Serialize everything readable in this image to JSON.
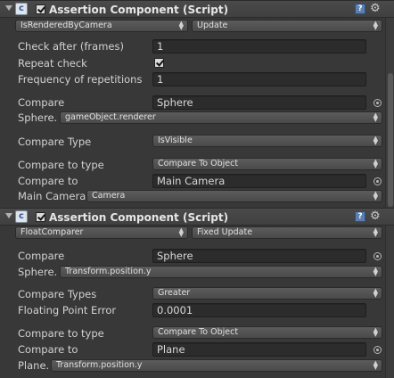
{
  "components": [
    {
      "title": "Assertion Component (Script)",
      "enabled": true,
      "type_popup": "IsRenderedByCamera",
      "update_popup": "Update",
      "check_after_label": "Check after (frames)",
      "check_after_value": "1",
      "repeat_check_label": "Repeat check",
      "repeat_check": true,
      "frequency_label": "Frequency of repetitions",
      "frequency_value": "1",
      "compare_label": "Compare",
      "compare_value": "Sphere",
      "sphere_label": "Sphere.",
      "sphere_popup": "gameObject.renderer",
      "compare_type_label": "Compare Type",
      "compare_type_popup": "IsVisible",
      "compare_to_type_label": "Compare to type",
      "compare_to_type_popup": "Compare To Object",
      "compare_to_label": "Compare to",
      "compare_to_value": "Main Camera",
      "target_label": "Main Camera.",
      "target_popup": "Camera"
    },
    {
      "title": "Assertion Component (Script)",
      "enabled": true,
      "type_popup": "FloatComparer",
      "update_popup": "Fixed Update",
      "compare_label": "Compare",
      "compare_value": "Sphere",
      "sphere_label": "Sphere.",
      "sphere_popup": "Transform.position.y",
      "compare_types_label": "Compare Types",
      "compare_types_popup": "Greater",
      "float_error_label": "Floating Point Error",
      "float_error_value": "0.0001",
      "compare_to_type_label": "Compare to type",
      "compare_to_type_popup": "Compare To Object",
      "compare_to_label": "Compare to",
      "compare_to_value": "Plane",
      "target_label": "Plane.",
      "target_popup": "Transform.position.y"
    }
  ],
  "icons": {
    "script": "script-icon",
    "help": "help-icon",
    "gear": "gear-icon",
    "target": "object-picker-icon",
    "foldout": "foldout-arrow-icon"
  },
  "colors": {
    "background": "#383838",
    "header": "#444444",
    "field": "#2c2c2c",
    "help": "#5b7fae"
  }
}
